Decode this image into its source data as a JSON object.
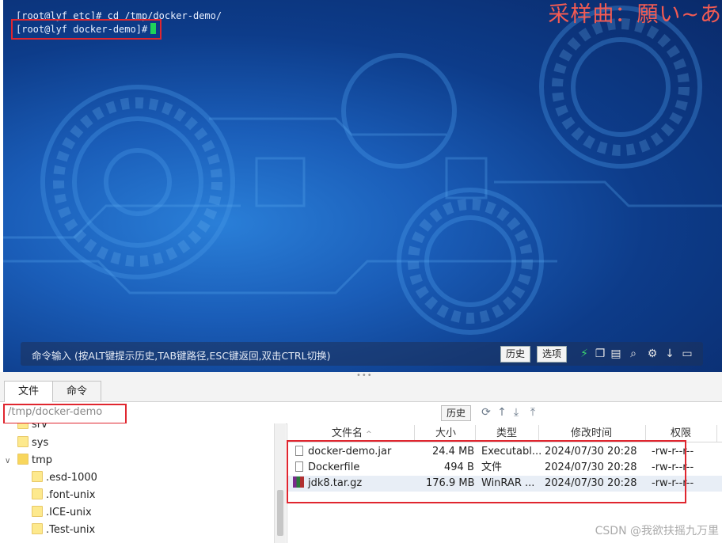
{
  "terminal": {
    "line1": "[root@lyf etc]# cd /tmp/docker-demo/",
    "line2": "[root@lyf docker-demo]#",
    "overlay_title": "采样曲：願い~あ",
    "command_hint": "命令输入 (按ALT键提示历史,TAB键路径,ESC键返回,双击CTRL切换)",
    "history_label": "历史",
    "options_label": "选项",
    "icons": [
      "bolt-icon",
      "copy-icon",
      "paste-icon",
      "search-icon",
      "gear-icon",
      "download-icon",
      "window-icon"
    ]
  },
  "tabs": [
    {
      "label": "文件"
    },
    {
      "label": "命令"
    }
  ],
  "pathbar": {
    "path": "/tmp/docker-demo",
    "history_label": "历史",
    "icons": [
      "refresh-icon",
      "up-icon",
      "download-icon",
      "upload-icon"
    ]
  },
  "tree": [
    {
      "label": "srv"
    },
    {
      "label": "sys"
    },
    {
      "label": "tmp"
    },
    {
      "label": ".esd-1000"
    },
    {
      "label": ".font-unix"
    },
    {
      "label": ".ICE-unix"
    },
    {
      "label": ".Test-unix"
    }
  ],
  "files": {
    "columns": [
      "文件名",
      "大小",
      "类型",
      "修改时间",
      "权限"
    ],
    "rows": [
      {
        "name": "docker-demo.jar",
        "size": "24.4 MB",
        "type": "Executabl...",
        "modified": "2024/07/30 20:28",
        "perm": "-rw-r--r--",
        "icon": "document-icon"
      },
      {
        "name": "Dockerfile",
        "size": "494 B",
        "type": "文件",
        "modified": "2024/07/30 20:28",
        "perm": "-rw-r--r--",
        "icon": "document-icon"
      },
      {
        "name": "jdk8.tar.gz",
        "size": "176.9 MB",
        "type": "WinRAR ...",
        "modified": "2024/07/30 20:28",
        "perm": "-rw-r--r--",
        "icon": "archive-icon"
      }
    ]
  },
  "watermark": "CSDN @我欲扶摇九万里",
  "colors": {
    "highlight": "#e0262f",
    "cursor": "#1fd45a",
    "terminal_bg": "#0d3c8a"
  }
}
